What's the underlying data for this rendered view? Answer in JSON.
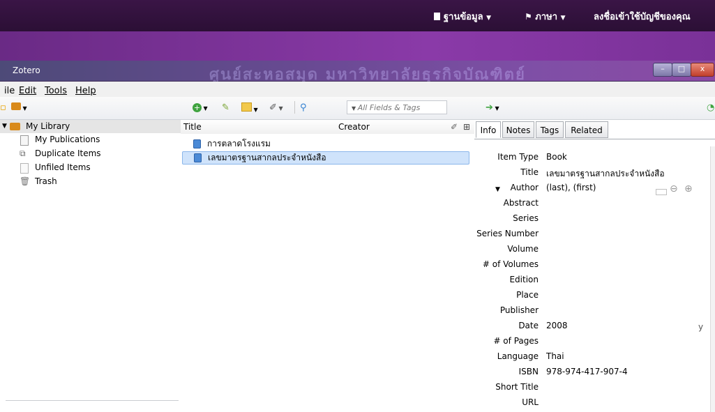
{
  "top_menu": {
    "database": "ฐานข้อมูล",
    "language": "ภาษา",
    "login": "ลงชื่อเข้าใช้บัญชีของคุณ"
  },
  "window": {
    "title": "Zotero",
    "watermark": "ศูนย์สะหอสมุด มหาวิทยาลัยธุรกิจบัณฑิตย์",
    "minimize": "–",
    "maximize": "□",
    "close": "x"
  },
  "menubar": {
    "file": "ile",
    "edit": "Edit",
    "tools": "Tools",
    "help": "Help"
  },
  "search": {
    "placeholder": "All Fields & Tags"
  },
  "library": {
    "root": "My Library",
    "items": [
      "My Publications",
      "Duplicate Items",
      "Unfiled Items",
      "Trash"
    ]
  },
  "columns": {
    "title": "Title",
    "creator": "Creator"
  },
  "items": [
    "การตลาดโรงแรม",
    "เลขมาตรฐานสากลประจำหนังสือ"
  ],
  "tabs": [
    "Info",
    "Notes",
    "Tags",
    "Related"
  ],
  "info": {
    "fields": [
      {
        "label": "Item Type",
        "value": "Book"
      },
      {
        "label": "Title",
        "value": "เลขมาตรฐานสากลประจำหนังสือ"
      },
      {
        "label": "Author",
        "value": "(last), (first)"
      },
      {
        "label": "Abstract",
        "value": ""
      },
      {
        "label": "Series",
        "value": ""
      },
      {
        "label": "Series Number",
        "value": ""
      },
      {
        "label": "Volume",
        "value": ""
      },
      {
        "label": "# of Volumes",
        "value": ""
      },
      {
        "label": "Edition",
        "value": ""
      },
      {
        "label": "Place",
        "value": ""
      },
      {
        "label": "Publisher",
        "value": ""
      },
      {
        "label": "Date",
        "value": "2008"
      },
      {
        "label": "# of Pages",
        "value": ""
      },
      {
        "label": "Language",
        "value": "Thai"
      },
      {
        "label": "ISBN",
        "value": "978-974-417-907-4"
      },
      {
        "label": "Short Title",
        "value": ""
      },
      {
        "label": "URL",
        "value": ""
      }
    ],
    "date_suffix": "y"
  },
  "icons": {
    "book": "book-icon",
    "folder": "folder-icon",
    "trash": "trash-icon",
    "new_item": "plus-circle-icon",
    "add_by_id": "magic-wand-icon",
    "new_note": "note-icon",
    "attach": "paperclip-icon",
    "search": "magnifier-icon",
    "locate": "arrow-right-icon"
  },
  "colors": {
    "accent": "#6a2a85",
    "selection": "#cfe3fb",
    "book": "#4b8ad6"
  }
}
